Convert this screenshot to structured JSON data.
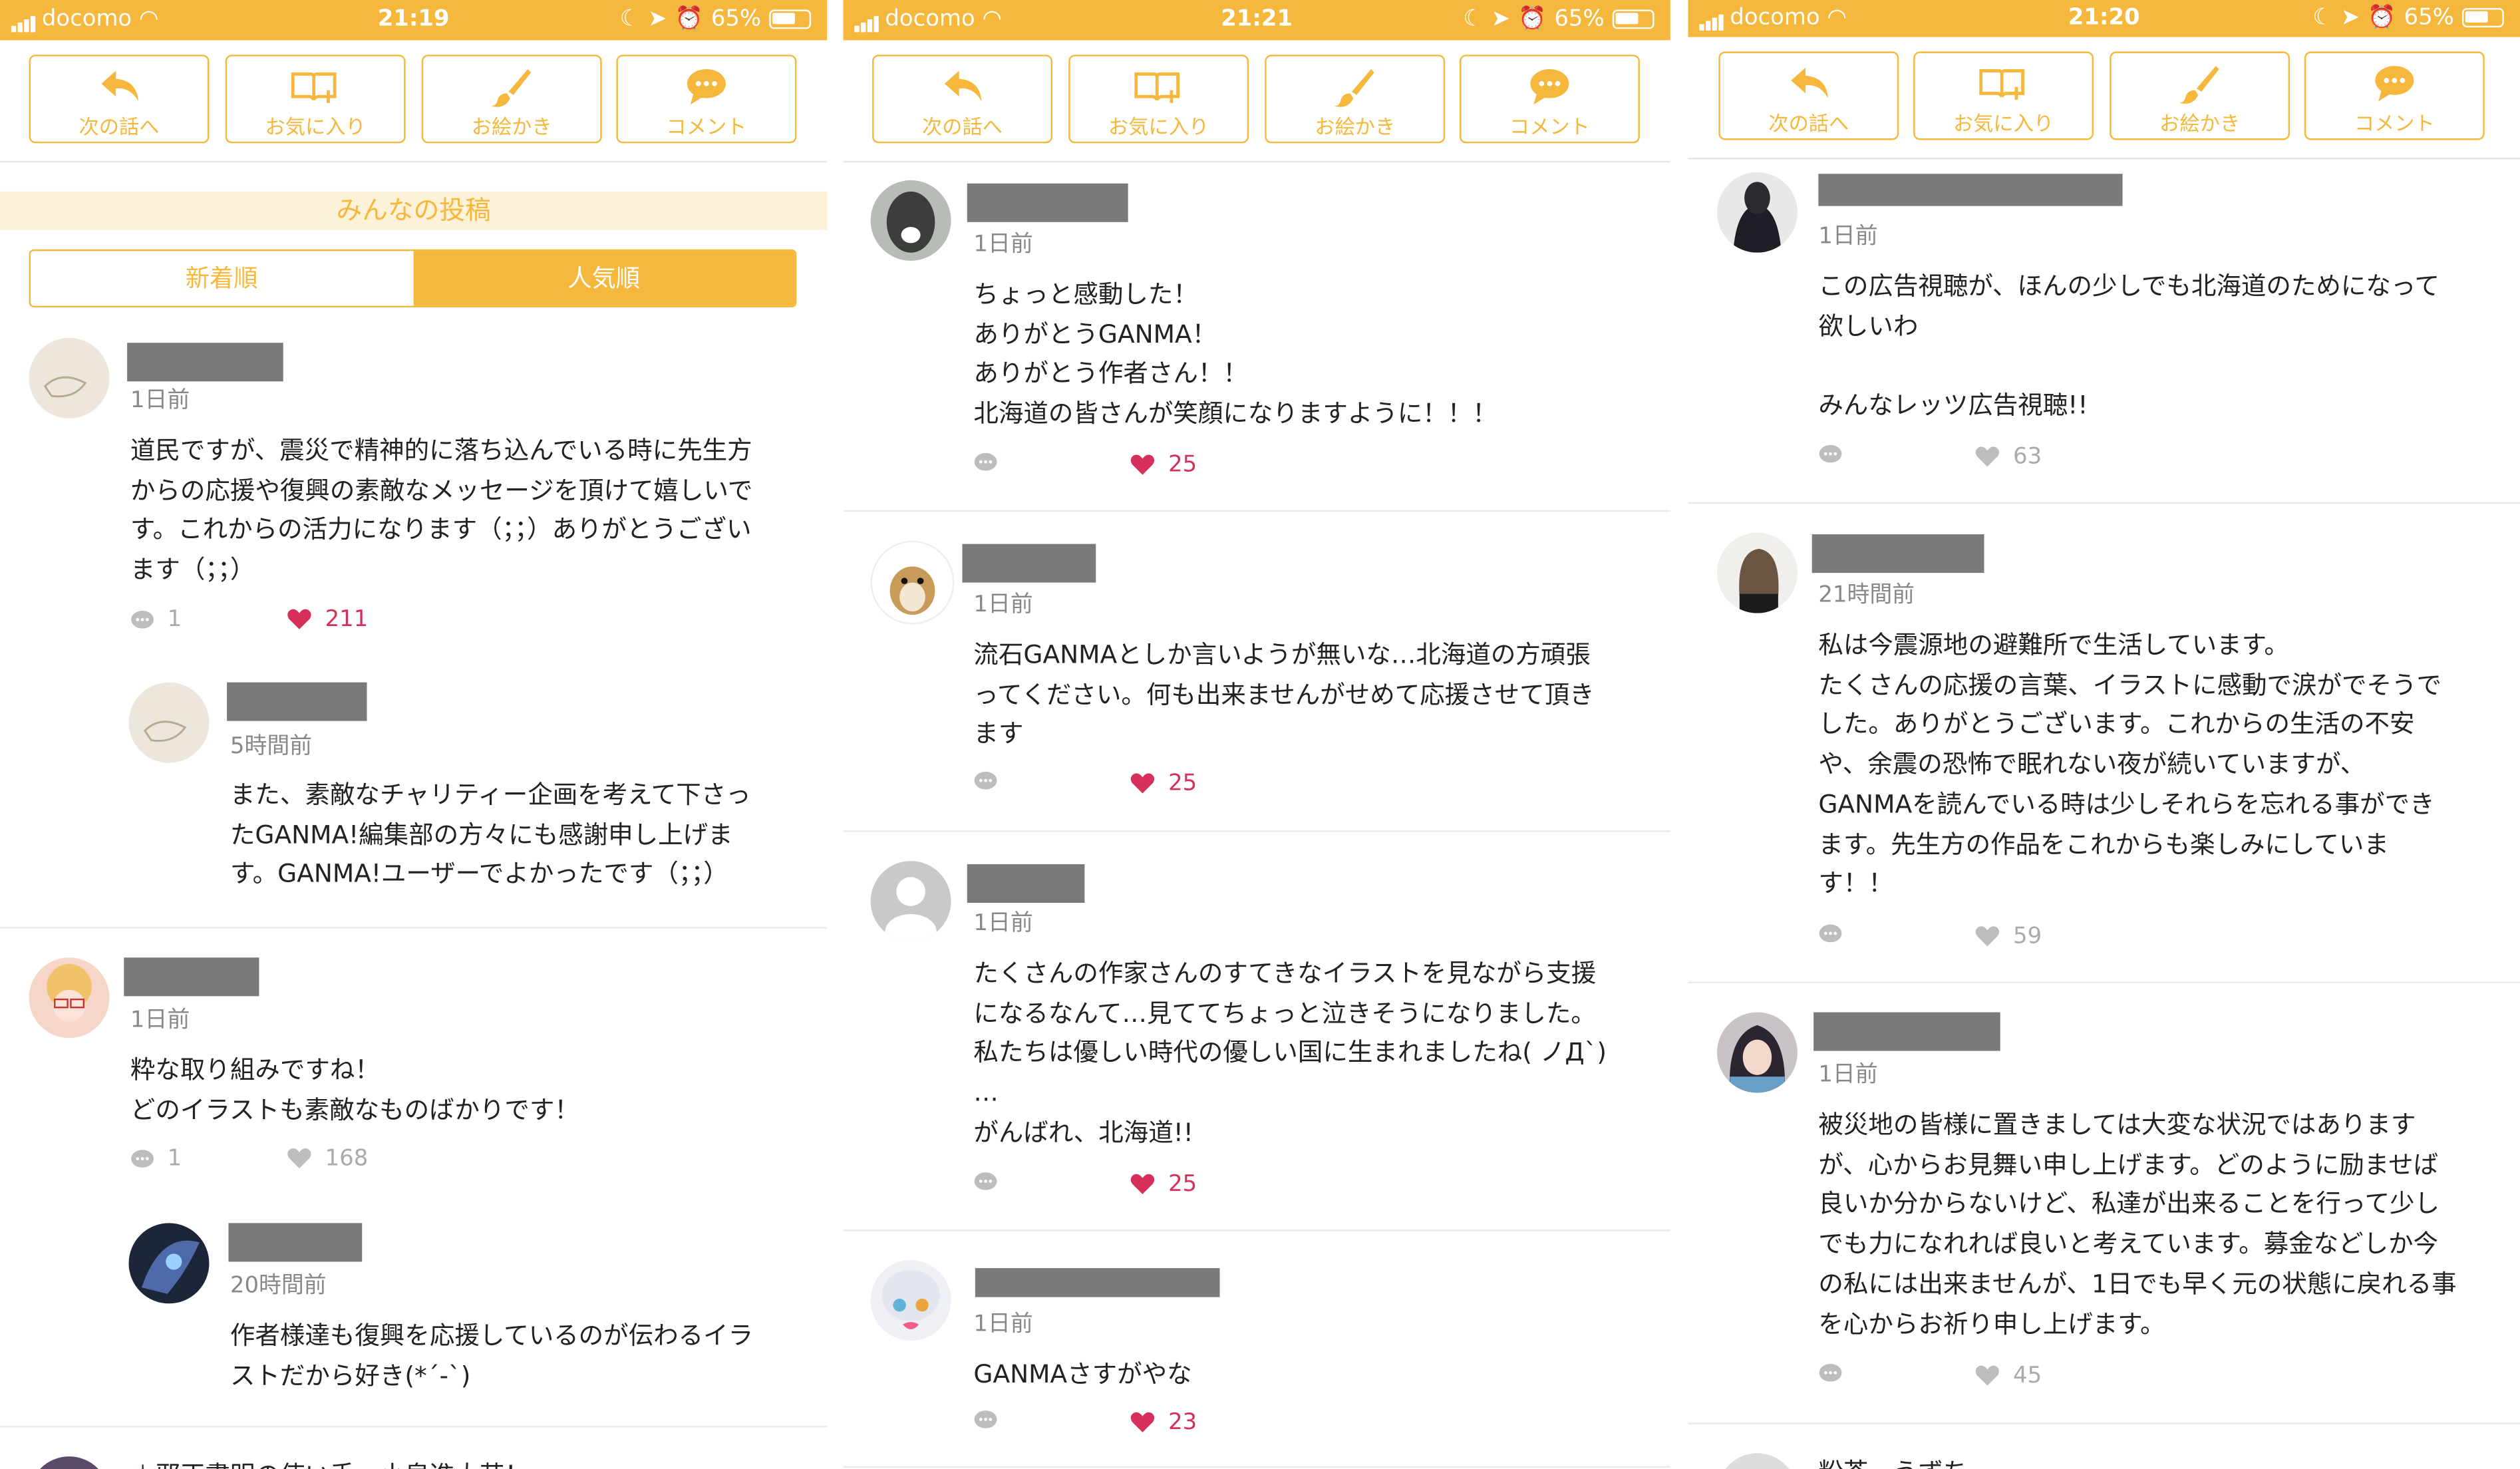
{
  "status": {
    "carrier": "docomo",
    "battery": "65%",
    "times": [
      "21:19",
      "21:21",
      "21:20"
    ]
  },
  "toolbar": {
    "next_label": "次の話へ",
    "favorite_label": "お気に入り",
    "draw_label": "お絵かき",
    "comment_label": "コメント"
  },
  "panel1": {
    "section_title": "みんなの投稿",
    "tab_new": "新着順",
    "tab_popular": "人気順",
    "c1": {
      "time": "1日前",
      "text": "道民ですが、震災で精神的に落ち込んでいる時に先生方\nからの応援や復興の素敵なメッセージを頂けて嬉しいで\nす。これからの活力になります（；；）ありがとうござい\nます（；；）",
      "replies": "1",
      "likes": "211"
    },
    "c1r": {
      "time": "5時間前",
      "text": "また、素敵なチャリティー企画を考えて下さっ\nたGANMA!編集部の方々にも感謝申し上げま\nす。GANMA!ユーザーでよかったです（；；）"
    },
    "c2": {
      "time": "1日前",
      "text": "粋な取り組みですね！\nどのイラストも素敵なものばかりです！",
      "replies": "1",
      "likes": "168"
    },
    "c2r": {
      "time": "20時間前",
      "text": "作者様達も復興を応援しているのが伝わるイラ\nストだから好き(*´-`)"
    },
    "c3_partial": "＊邪正書明の使い手　小泉進太芸！"
  },
  "panel2": {
    "c1": {
      "time": "1日前",
      "text": "ちょっと感動した！\nありがとうGANMA！\nありがとう作者さん！！\n北海道の皆さんが笑顔になりますように！！！",
      "likes": "25"
    },
    "c2": {
      "time": "1日前",
      "text": "流石GANMAとしか言いようが無いな…北海道の方頑張\nってください。何も出来ませんがせめて応援させて頂き\nます",
      "likes": "25"
    },
    "c3": {
      "time": "1日前",
      "text": "たくさんの作家さんのすてきなイラストを見ながら支援\nになるなんて…見ててちょっと泣きそうになりました。\n私たちは優しい時代の優しい国に生まれましたね( ノД`)\n…\nがんばれ、北海道!!",
      "likes": "25"
    },
    "c4": {
      "time": "1日前",
      "text": "GANMAさすがやな",
      "likes": "23"
    }
  },
  "panel3": {
    "c1": {
      "time": "1日前",
      "text": "この広告視聴が、ほんの少しでも北海道のためになって\n欲しいわ\n\nみんなレッツ広告視聴!!",
      "likes": "63"
    },
    "c2": {
      "time": "21時間前",
      "text": "私は今震源地の避難所で生活しています。\nたくさんの応援の言葉、イラストに感動で涙がでそうで\nした。ありがとうございます。これからの生活の不安\nや、余震の恐怖で眠れない夜が続いていますが、\nGANMAを読んでいる時は少しそれらを忘れる事ができ\nます。先生方の作品をこれからも楽しみにしていま\nす！！",
      "likes": "59"
    },
    "c3": {
      "time": "1日前",
      "text": "被災地の皆様に置きましては大変な状況ではあります\nが、心からお見舞い申し上げます。どのように励ませば\n良いか分からないけど、私達が出来ることを行って少し\nでも力になれれば良いと考えています。募金などしか今\nの私には出来ませんが、1日でも早く元の状態に戻れる事\nを心からお祈り申し上げます。",
      "likes": "45"
    },
    "c4_partial": "粉茶　うずち"
  },
  "colors": {
    "accent": "#f5b83d",
    "heart_liked": "#d6305a",
    "heart_default": "#bdbdbd"
  }
}
